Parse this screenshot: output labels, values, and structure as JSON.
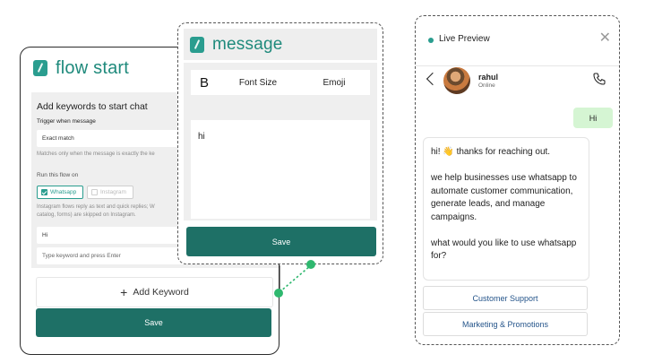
{
  "flow_card": {
    "title": "flow start",
    "section_title": "Add keywords to start chat",
    "trigger_label": "Trigger when message",
    "trigger_value": "Exact match",
    "trigger_help": "Matches only when the message is exactly the ke",
    "run_label": "Run this flow on",
    "channels": [
      {
        "label": "Whatsapp",
        "checked": true
      },
      {
        "label": "Instagram",
        "checked": false
      }
    ],
    "instagram_note_line1": "Instagram flows reply as text and quick replies; W",
    "instagram_note_line2": "catalog, forms) are skipped on Instagram.",
    "keyword_value": "Hi",
    "keyword_placeholder": "Type keyword and press Enter",
    "add_keyword_label": "Add Keyword",
    "save_label": "Save"
  },
  "message_card": {
    "title": "message",
    "toolbar": {
      "bold": "B",
      "font_size": "Font Size",
      "emoji": "Emoji"
    },
    "body_text": "hi",
    "save_label": "Save"
  },
  "live_preview": {
    "title": "Live Preview",
    "contact_name": "rahul",
    "contact_status": "Online",
    "outgoing_message": "Hi",
    "incoming_lines": [
      "hi! 👋 thanks for reaching out.",
      "we help businesses use whatsapp to automate customer communication, generate leads, and manage campaigns.",
      "what would you like to use whatsapp for?"
    ],
    "quick_replies": [
      "Customer Support",
      "Marketing & Promotions"
    ]
  },
  "colors": {
    "brand_teal": "#2a9d8f",
    "save_button": "#1e7066",
    "connector_dot": "#2fb86f",
    "outgoing_bubble": "#d5f5d3",
    "quick_reply_text": "#24548a"
  }
}
